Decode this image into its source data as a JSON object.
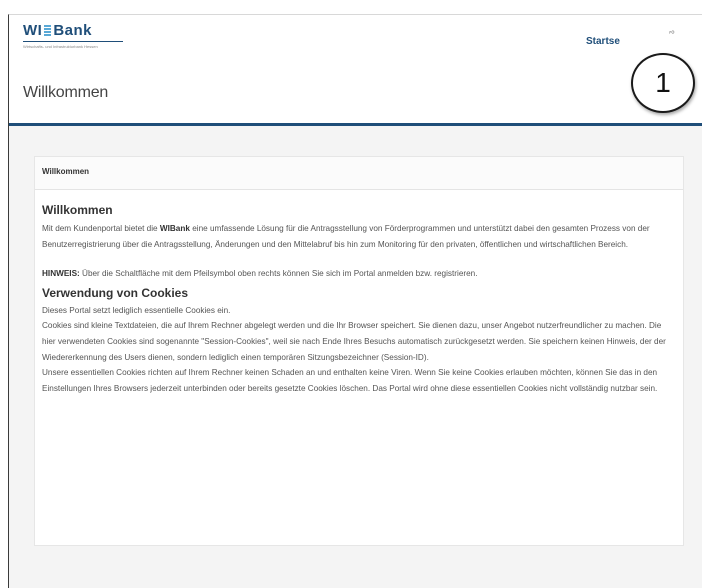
{
  "header": {
    "logo": {
      "wi": "WI",
      "bank": "Bank",
      "subtitle": "Wirtschafts- und Infrastrukturbank Hessen"
    },
    "nav_start": "Startse",
    "nav_extra": "′°",
    "page_title": "Willkommen"
  },
  "callout": {
    "number": "1"
  },
  "panel": {
    "header": "Willkommen",
    "welcome": {
      "heading": "Willkommen",
      "intro_before": "Mit dem Kundenportal bietet die ",
      "intro_brand": "WIBank",
      "intro_after": " eine umfassende Lösung für die Antragsstellung von Förderprogrammen und unterstützt dabei den gesamten Prozess von der Benutzerregistrierung über die Antragsstellung, Änderungen und den Mittelabruf bis hin zum Monitoring für den privaten, öffentlichen und wirtschaftlichen Bereich.",
      "hint_label": "HINWEIS:",
      "hint_text": " Über die Schaltfläche mit dem Pfeilsymbol oben rechts können Sie sich im Portal anmelden bzw. registrieren."
    },
    "cookies": {
      "heading": "Verwendung von Cookies",
      "p1": "Dieses Portal setzt lediglich essentielle Cookies ein.",
      "p2": "Cookies sind kleine Textdateien, die auf Ihrem Rechner abgelegt werden und die Ihr Browser speichert. Sie dienen dazu, unser Angebot nutzerfreundlicher zu machen. Die hier verwendeten Cookies sind sogenannte \"Session-Cookies\", weil sie nach Ende Ihres Besuchs automatisch zurückgesetzt werden. Sie speichern keinen Hinweis, der der Wiedererkennung des Users dienen, sondern lediglich einen temporären Sitzungsbezeichner (Session-ID).",
      "p3": "Unsere essentiellen Cookies richten auf Ihrem Rechner keinen Schaden an und enthalten keine Viren. Wenn Sie keine Cookies erlauben möchten, können Sie das in den Einstellungen Ihres Browsers jederzeit unterbinden oder bereits gesetzte Cookies löschen. Das Portal wird ohne diese essentiellen Cookies nicht vollständig nutzbar sein."
    }
  }
}
